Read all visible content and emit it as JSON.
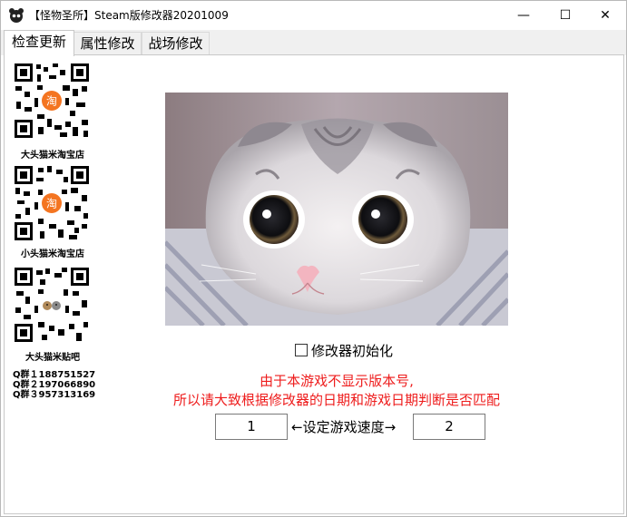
{
  "window": {
    "title": "【怪物圣所】Steam版修改器20201009"
  },
  "title_buttons": {
    "minimize": "—",
    "maximize": "☐",
    "close": "✕"
  },
  "tabs": [
    {
      "label": "检查更新",
      "active": true
    },
    {
      "label": "属性修改",
      "active": false
    },
    {
      "label": "战场修改",
      "active": false
    }
  ],
  "sidebar": {
    "shops": [
      {
        "label": "大头猫米淘宝店",
        "badge": "淘"
      },
      {
        "label": "小头猫米淘宝店",
        "badge": "淘"
      },
      {
        "label": "大头猫米贴吧",
        "badge": ""
      }
    ],
    "groups": [
      "Q群１188751527",
      "Q群２197066890",
      "Q群３957313169"
    ]
  },
  "main": {
    "init_checkbox": {
      "label": "修改器初始化",
      "checked": false
    },
    "notice_line1": "由于本游戏不显示版本号,",
    "notice_line2": "所以请大致根据修改器的日期和游戏日期判断是否匹配",
    "speed": {
      "left_value": "1",
      "label": "←设定游戏速度→",
      "right_value": "2"
    }
  },
  "colors": {
    "notice": "#ee1c1c",
    "tab_bg": "#f0f0f0",
    "badge": "#f47521"
  }
}
